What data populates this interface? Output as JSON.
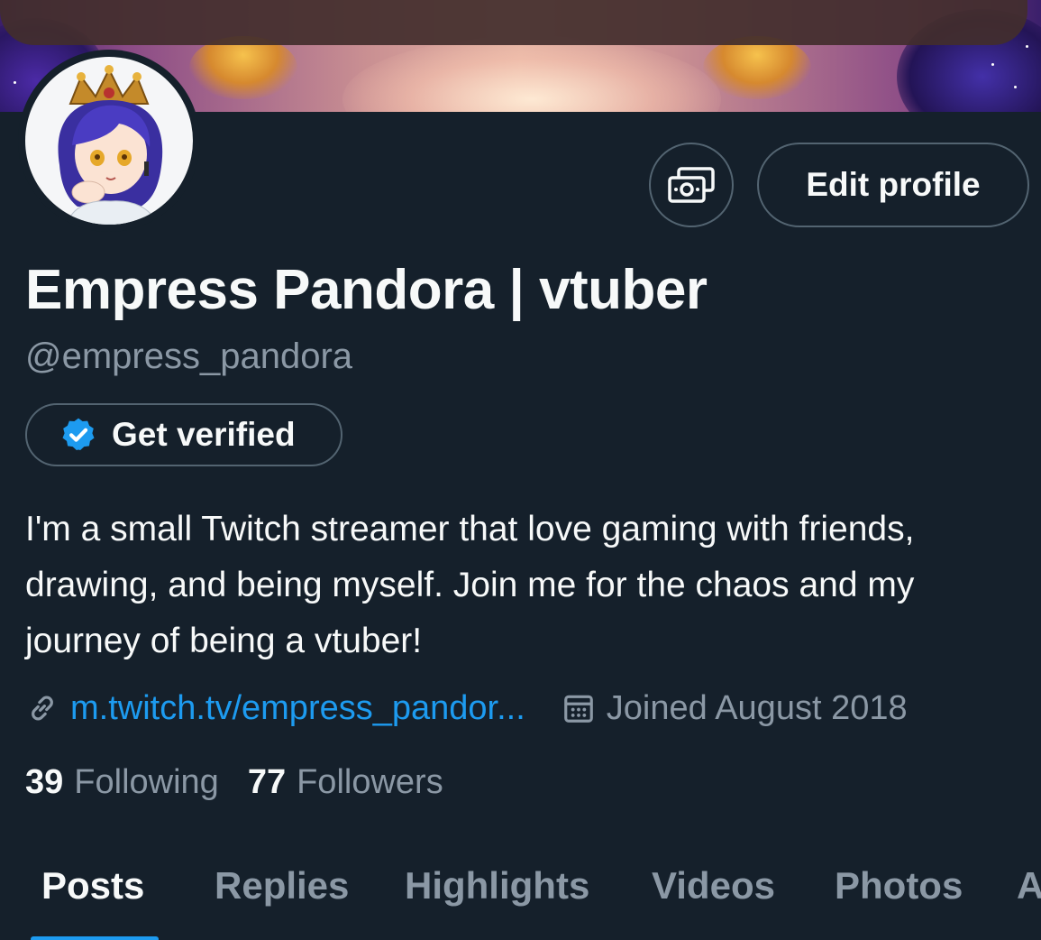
{
  "profile": {
    "display_name": "Empress Pandora | vtuber",
    "handle": "@empress_pandora",
    "bio": "I'm a small Twitch streamer that love gaming with friends, drawing, and being myself. Join me for the chaos and my journey of being a vtuber!",
    "link": "m.twitch.tv/empress_pandor...",
    "joined": "Joined August 2018"
  },
  "actions": {
    "tip_icon": "money-icon",
    "edit_label": "Edit profile",
    "verify_label": "Get verified",
    "verify_icon": "verified-badge-icon"
  },
  "stats": {
    "following_count": "39",
    "following_label": "Following",
    "followers_count": "77",
    "followers_label": "Followers"
  },
  "tabs": {
    "posts": "Posts",
    "replies": "Replies",
    "highlights": "Highlights",
    "videos": "Videos",
    "photos": "Photos",
    "overflow": "A"
  },
  "colors": {
    "background": "#15202b",
    "text_primary": "#f7f9f9",
    "text_secondary": "#8b98a5",
    "accent": "#1d9bf0",
    "border": "#536471"
  }
}
